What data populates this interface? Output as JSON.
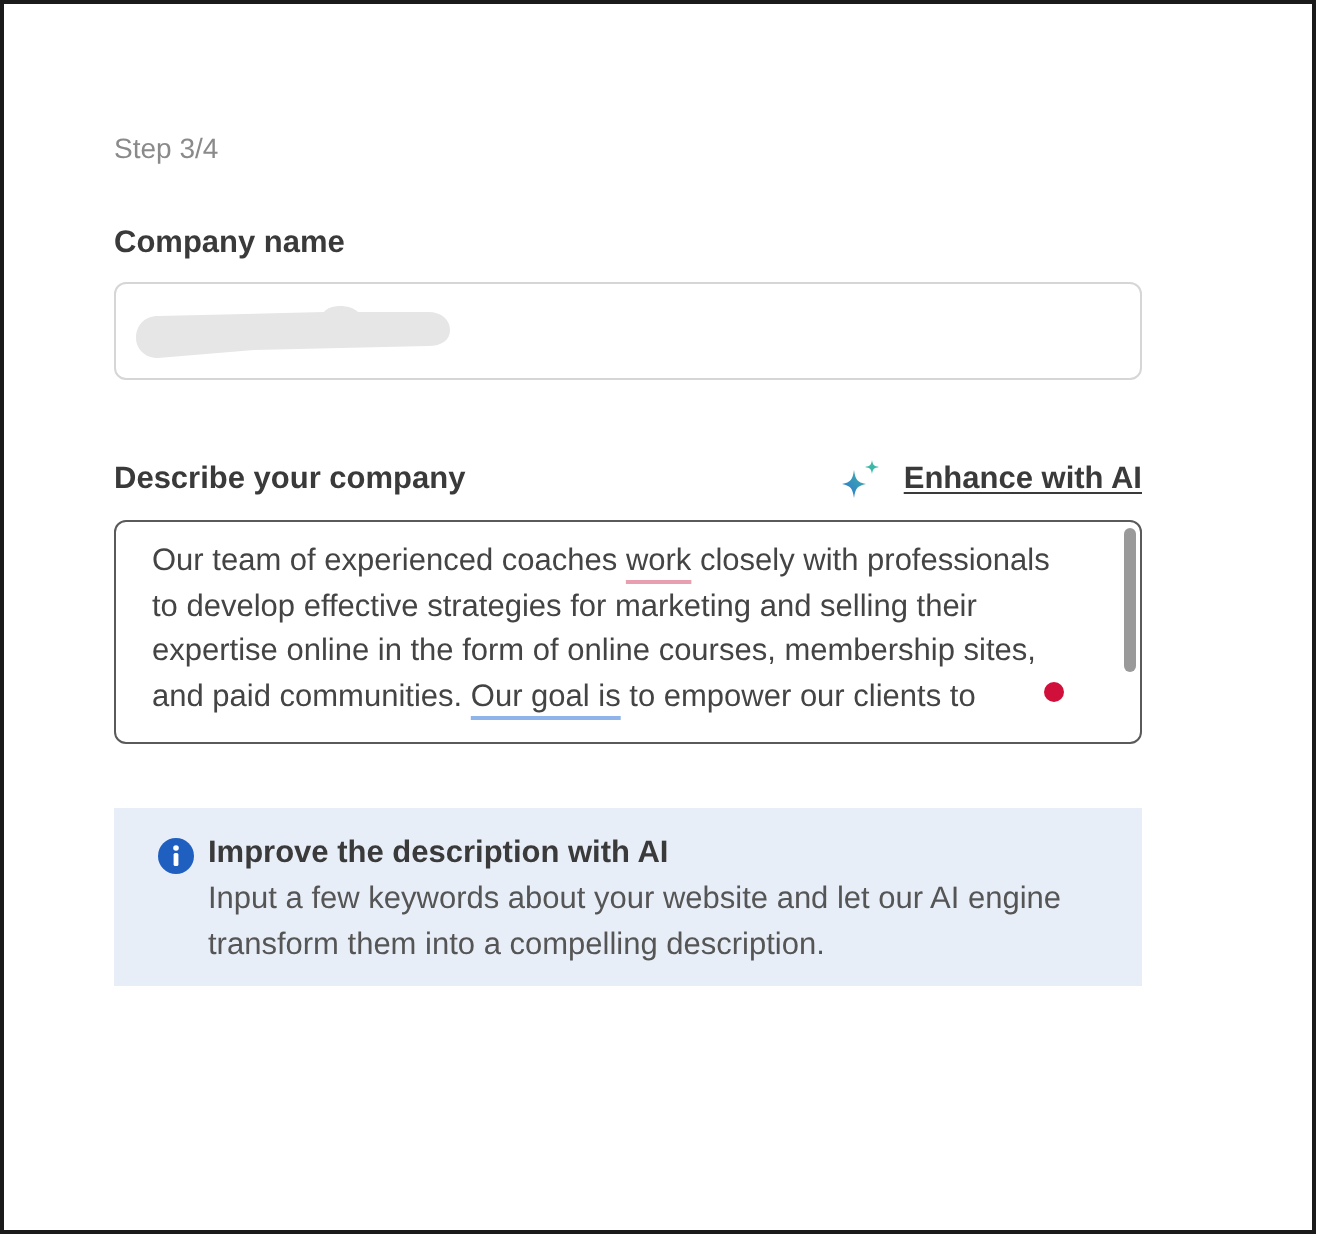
{
  "step": "Step 3/4",
  "company_name": {
    "label": "Company name",
    "redacted": true
  },
  "description": {
    "label": "Describe your company",
    "enhance_link": "Enhance with AI",
    "segments": [
      {
        "text": "Our team of experienced coaches ",
        "kind": "plain"
      },
      {
        "text": "work",
        "kind": "spelling"
      },
      {
        "text": " closely with professionals to develop effective strategies for marketing and selling their expertise online in the form of online courses, membership sites, and paid communities. ",
        "kind": "plain"
      },
      {
        "text": "Our goal is",
        "kind": "grammar"
      },
      {
        "text": " to empower our clients to",
        "kind": "plain"
      }
    ],
    "issue_dot": true
  },
  "info": {
    "title": "Improve the description with AI",
    "body": "Input a few keywords about your website and let our AI engine transform them into a compelling description."
  }
}
